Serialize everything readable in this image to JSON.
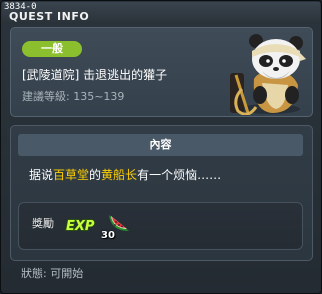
{
  "window": {
    "quest_id": "3834-0",
    "title": "QUEST INFO"
  },
  "quest": {
    "category_badge": "一般",
    "name": "[武陵道院] 击退逃出的獾子",
    "level_label": "建議等級:",
    "level_range": "135~139"
  },
  "content": {
    "header": "內容",
    "description": {
      "part1": "据说",
      "place": "百草堂",
      "part2": "的",
      "person": "黄船长",
      "part3": "有一个烦恼……"
    }
  },
  "reward": {
    "label": "獎勵",
    "exp_icon": "exp-icon",
    "item_icon": "watermelon-slice-icon",
    "item_count": "30"
  },
  "status": {
    "text": "狀態:  可開始"
  },
  "colors": {
    "badge": "#8cbf2e",
    "highlight": "#ffd000",
    "section_header": "#4a5967"
  }
}
